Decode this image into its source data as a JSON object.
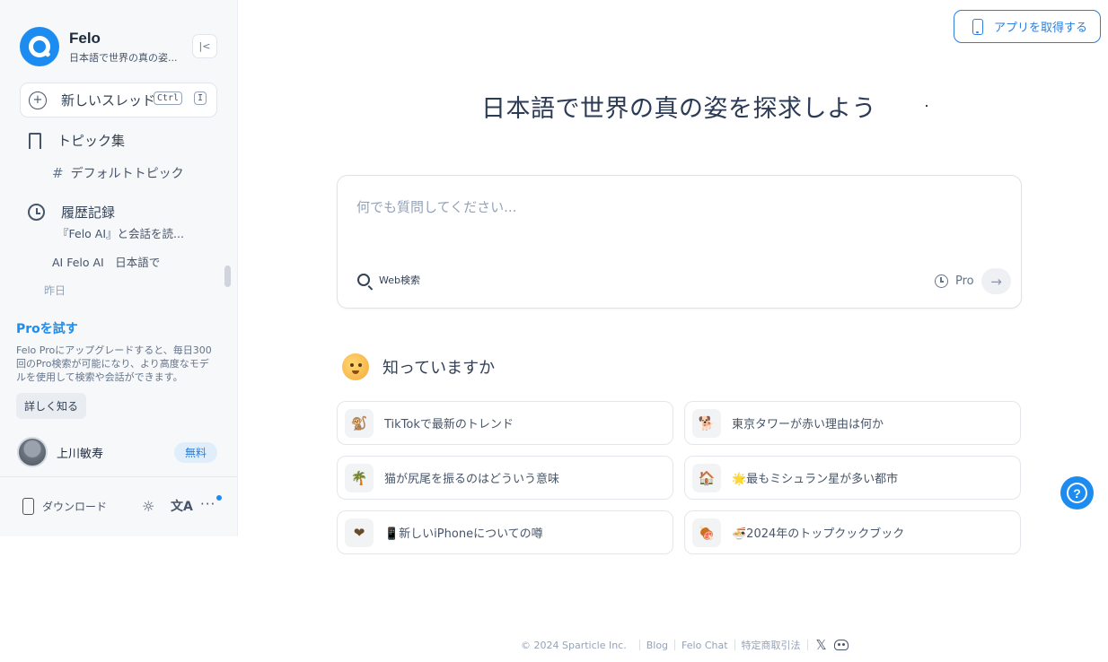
{
  "sidebar": {
    "brand_name": "Felo",
    "brand_subtitle": "日本語で世界の真の姿...",
    "collapse_icon": "collapse-left-icon",
    "new_thread": {
      "label": "新しいスレッド",
      "shortcut_1": "Ctrl",
      "shortcut_2": "I"
    },
    "topics_label": "トピック集",
    "default_topic_label": "デフォルトトピック",
    "history_label": "履歴記録",
    "history_items": [
      {
        "text": "『Felo AI』と会話を読..."
      },
      {
        "text": "AI Felo AI　日本語で"
      }
    ],
    "history_date": "昨日",
    "pro": {
      "title": "Proを試す",
      "description": "Felo Proにアップグレードすると、毎日300回のPro検索が可能になり、より高度なモデルを使用して検索や会話ができます。",
      "button": "詳しく知る"
    },
    "user": {
      "name": "上川敏寿",
      "plan_badge": "無料"
    },
    "download_label": "ダウンロード"
  },
  "header": {
    "get_app_label": "アプリを取得する"
  },
  "main": {
    "headline": "日本語で世界の真の姿を探求しよう",
    "search": {
      "placeholder": "何でも質問してください...",
      "web_toggle_label": "Web検索",
      "pro_toggle_label": "Pro"
    },
    "know_title": "知っていますか",
    "suggestions": [
      {
        "icon": "🐒",
        "text": "TikTokで最新のトレンド"
      },
      {
        "icon": "🐕",
        "text": "東京タワーが赤い理由は何か"
      },
      {
        "icon": "🌴",
        "text": "猫が尻尾を振るのはどういう意味"
      },
      {
        "icon": "🏠",
        "text": "🌟最もミシュラン星が多い都市"
      },
      {
        "icon": "❤",
        "text": "📱新しいiPhoneについての噂"
      },
      {
        "icon": "🍖",
        "text": "🍜2024年のトップクックブック"
      }
    ]
  },
  "footer": {
    "copyright": "© 2024 Sparticle Inc.",
    "links": [
      "Blog",
      "Felo Chat",
      "特定商取引法"
    ]
  },
  "colors": {
    "accent": "#1d8cf0",
    "sidebar_bg": "#f7f8fa",
    "headline": "#2b3a55"
  }
}
